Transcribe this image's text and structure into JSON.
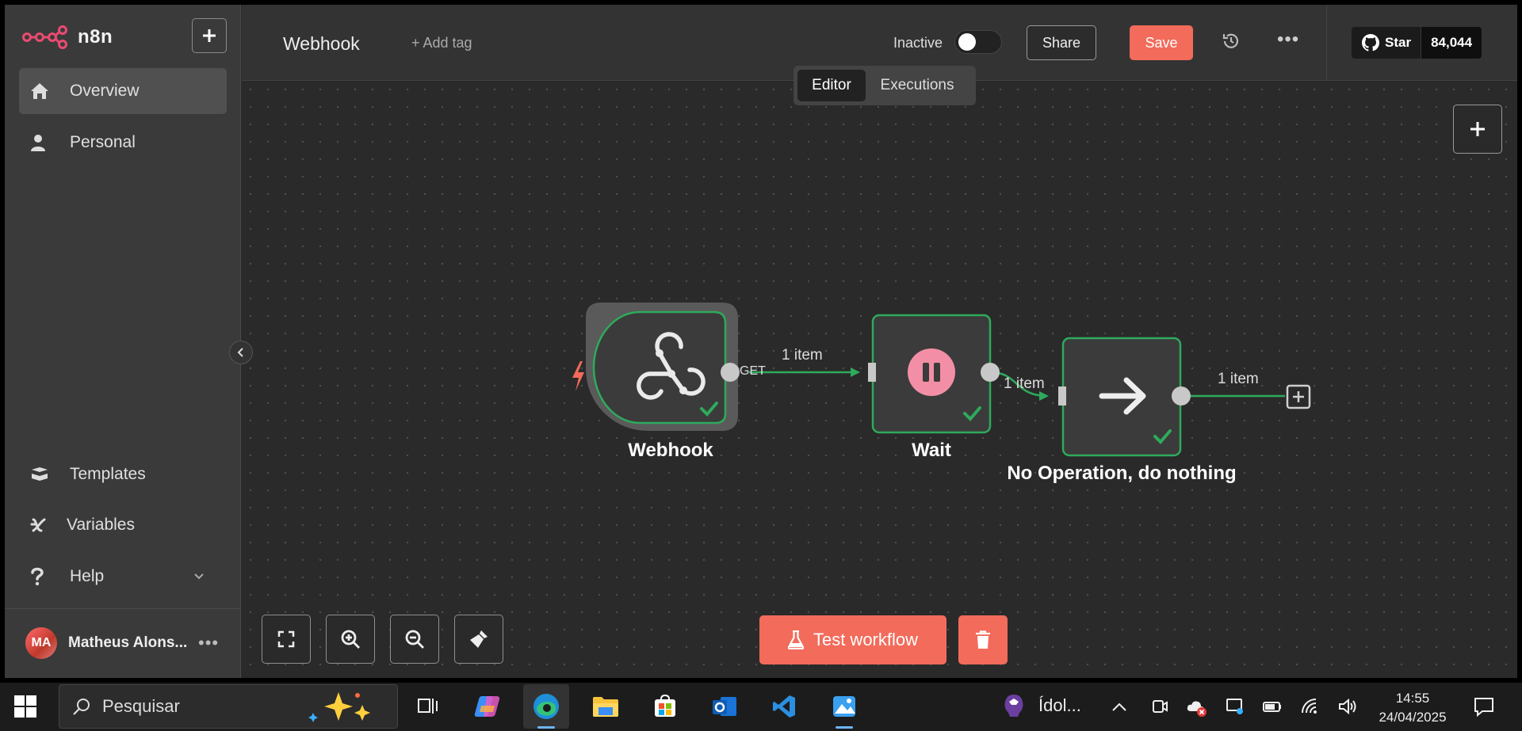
{
  "sidebar": {
    "logo_text": "n8n",
    "items": [
      {
        "label": "Overview",
        "icon": "home-icon"
      },
      {
        "label": "Personal",
        "icon": "user-icon"
      }
    ],
    "bottom_items": [
      {
        "label": "Templates",
        "icon": "templates-icon"
      },
      {
        "label": "Variables",
        "icon": "variables-icon"
      },
      {
        "label": "Help",
        "icon": "help-icon"
      }
    ],
    "user": {
      "initials": "MA",
      "name": "Matheus Alons..."
    }
  },
  "header": {
    "workflow_name": "Webhook",
    "add_tag": "+ Add tag",
    "status_label": "Inactive",
    "share_label": "Share",
    "save_label": "Save",
    "github": {
      "star_label": "Star",
      "count": "84,044"
    }
  },
  "tabs": [
    {
      "label": "Editor",
      "active": true
    },
    {
      "label": "Executions",
      "active": false
    }
  ],
  "canvas": {
    "nodes": [
      {
        "name": "Webhook",
        "icon": "webhook-icon",
        "status": "success"
      },
      {
        "name": "Wait",
        "icon": "pause-icon",
        "status": "success"
      },
      {
        "name": "No Operation, do nothing",
        "icon": "arrow-right-icon",
        "status": "success"
      }
    ],
    "edges": [
      {
        "from": "Webhook",
        "to": "Wait",
        "label": "1 item",
        "output": "GET"
      },
      {
        "from": "Wait",
        "to": "No Operation, do nothing",
        "label": "1 item"
      },
      {
        "from": "No Operation, do nothing",
        "to": "add",
        "label": "1 item"
      }
    ],
    "test_button_label": "Test workflow"
  },
  "taskbar": {
    "search_placeholder": "Pesquisar",
    "news_text": "Ídol...",
    "time": "14:55",
    "date": "24/04/2025"
  },
  "colors": {
    "accent": "#f26b5b",
    "success": "#2eaa5c",
    "node_bg": "#3b3b3b",
    "wait_icon": "#f28fa6"
  }
}
